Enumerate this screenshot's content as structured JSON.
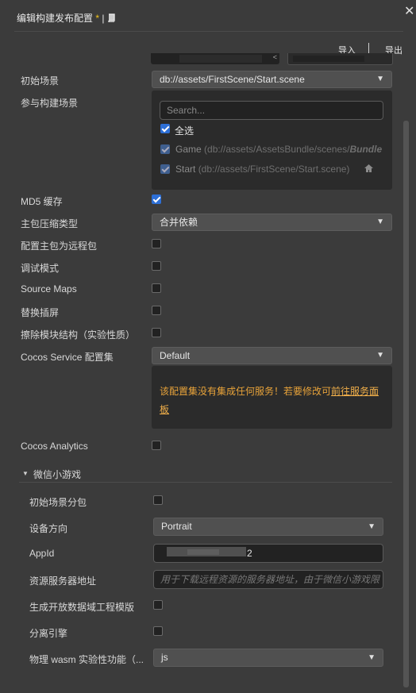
{
  "window": {
    "title": "编辑构建发布配置",
    "modified_marker": "*",
    "separator": "|",
    "close_label": "✕"
  },
  "toolbar": {
    "import_label": "导入",
    "export_label": "导出"
  },
  "fields": {
    "start_scene": {
      "label": "初始场景",
      "value": "db://assets/FirstScene/Start.scene"
    },
    "build_scenes": {
      "label": "参与构建场景",
      "search_placeholder": "Search...",
      "select_all_label": "全选",
      "scenes": [
        {
          "name": "Game",
          "path": "(db://assets/AssetsBundle/scenes/",
          "bundle": "Bundle"
        },
        {
          "name": "Start",
          "path": "(db://assets/FirstScene/Start.scene)"
        }
      ]
    },
    "md5_cache": {
      "label": "MD5 缓存",
      "checked": true
    },
    "main_bundle_compression": {
      "label": "主包压缩类型",
      "value": "合并依赖"
    },
    "main_bundle_remote": {
      "label": "配置主包为远程包",
      "checked": false
    },
    "debug_mode": {
      "label": "调试模式",
      "checked": false
    },
    "source_maps": {
      "label": "Source Maps",
      "checked": false
    },
    "replace_splash": {
      "label": "替换插屏",
      "checked": false
    },
    "erase_module": {
      "label": "擦除模块结构（实验性质）",
      "checked": false
    },
    "cocos_service": {
      "label": "Cocos Service 配置集",
      "value": "Default",
      "warning_text": "该配置集没有集成任何服务！若要修改可",
      "warning_link": "前往服务面板"
    },
    "cocos_analytics": {
      "label": "Cocos Analytics",
      "checked": false
    }
  },
  "wechat": {
    "section_title": "微信小游戏",
    "start_scene_subpackage": {
      "label": "初始场景分包",
      "checked": false
    },
    "orientation": {
      "label": "设备方向",
      "value": "Portrait"
    },
    "appid": {
      "label": "AppId",
      "value_suffix": "2"
    },
    "remote_server": {
      "label": "资源服务器地址",
      "placeholder": "用于下载远程资源的服务器地址，由于微信小游戏限"
    },
    "open_data_template": {
      "label": "生成开放数据域工程模版",
      "checked": false
    },
    "separate_engine": {
      "label": "分离引擎",
      "checked": false
    },
    "physics_wasm": {
      "label": "物理 wasm 实验性功能（...",
      "value": "js"
    }
  },
  "colors": {
    "background": "#3b3b3b",
    "accent": "#2d6fd6",
    "warning": "#e8a33a",
    "modified": "#f0c21a"
  },
  "icons": [
    "close-icon",
    "book-icon",
    "dropdown-arrow-icon",
    "checkbox-icon",
    "home-icon",
    "caret-down-icon"
  ]
}
